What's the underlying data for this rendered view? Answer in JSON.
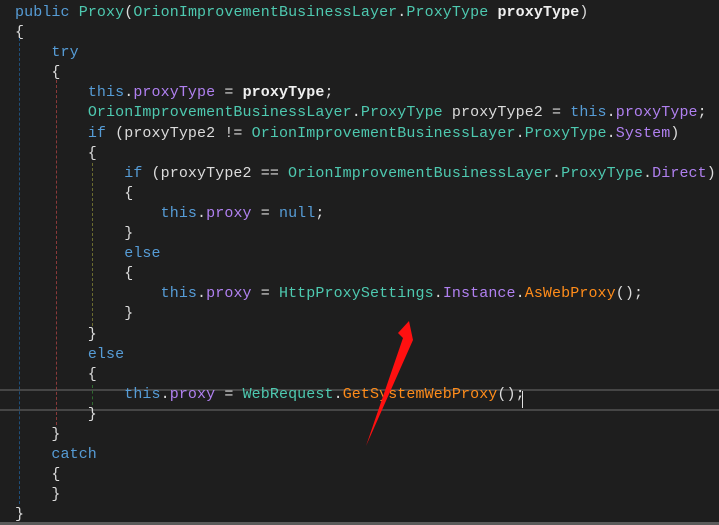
{
  "colors": {
    "background": "#1e1e1e",
    "keyword": "#569cd6",
    "type": "#4ec9b0",
    "member": "#b080f0",
    "method": "#ff8c1a",
    "annotation_arrow": "#ff1010"
  },
  "code": {
    "lines": [
      [
        [
          "public ",
          "kw"
        ],
        [
          "Proxy",
          "ty"
        ],
        [
          "(",
          "pu"
        ],
        [
          "OrionImprovementBusinessLayer",
          "ty"
        ],
        [
          ".",
          "pu"
        ],
        [
          "ProxyType",
          "ty"
        ],
        [
          " ",
          "pu"
        ],
        [
          "proxyType",
          "bo"
        ],
        [
          ")",
          "pu"
        ]
      ],
      [
        [
          "{",
          "pu"
        ]
      ],
      [
        [
          "    ",
          "pu"
        ],
        [
          "try",
          "kw"
        ]
      ],
      [
        [
          "    {",
          "pu"
        ]
      ],
      [
        [
          "        ",
          "pu"
        ],
        [
          "this",
          "kw"
        ],
        [
          ".",
          "pu"
        ],
        [
          "proxyType",
          "pr"
        ],
        [
          " = ",
          "pu"
        ],
        [
          "proxyType",
          "bo"
        ],
        [
          ";",
          "pu"
        ]
      ],
      [
        [
          "        ",
          "pu"
        ],
        [
          "OrionImprovementBusinessLayer",
          "ty"
        ],
        [
          ".",
          "pu"
        ],
        [
          "ProxyType",
          "ty"
        ],
        [
          " proxyType2 = ",
          "pu"
        ],
        [
          "this",
          "kw"
        ],
        [
          ".",
          "pu"
        ],
        [
          "proxyType",
          "pr"
        ],
        [
          ";",
          "pu"
        ]
      ],
      [
        [
          "        ",
          "pu"
        ],
        [
          "if",
          "kw"
        ],
        [
          " (proxyType2 != ",
          "pu"
        ],
        [
          "OrionImprovementBusinessLayer",
          "ty"
        ],
        [
          ".",
          "pu"
        ],
        [
          "ProxyType",
          "ty"
        ],
        [
          ".",
          "pu"
        ],
        [
          "System",
          "en"
        ],
        [
          ")",
          "pu"
        ]
      ],
      [
        [
          "        {",
          "pu"
        ]
      ],
      [
        [
          "            ",
          "pu"
        ],
        [
          "if",
          "kw"
        ],
        [
          " (proxyType2 == ",
          "pu"
        ],
        [
          "OrionImprovementBusinessLayer",
          "ty"
        ],
        [
          ".",
          "pu"
        ],
        [
          "ProxyType",
          "ty"
        ],
        [
          ".",
          "pu"
        ],
        [
          "Direct",
          "en"
        ],
        [
          ")",
          "pu"
        ]
      ],
      [
        [
          "            {",
          "pu"
        ]
      ],
      [
        [
          "                ",
          "pu"
        ],
        [
          "this",
          "kw"
        ],
        [
          ".",
          "pu"
        ],
        [
          "proxy",
          "pr"
        ],
        [
          " = ",
          "pu"
        ],
        [
          "null",
          "kw"
        ],
        [
          ";",
          "pu"
        ]
      ],
      [
        [
          "            }",
          "pu"
        ]
      ],
      [
        [
          "            ",
          "pu"
        ],
        [
          "else",
          "kw"
        ]
      ],
      [
        [
          "            {",
          "pu"
        ]
      ],
      [
        [
          "                ",
          "pu"
        ],
        [
          "this",
          "kw"
        ],
        [
          ".",
          "pu"
        ],
        [
          "proxy",
          "pr"
        ],
        [
          " = ",
          "pu"
        ],
        [
          "HttpProxySettings",
          "ty"
        ],
        [
          ".",
          "pu"
        ],
        [
          "Instance",
          "pr"
        ],
        [
          ".",
          "pu"
        ],
        [
          "AsWebProxy",
          "me"
        ],
        [
          "();",
          "pu"
        ]
      ],
      [
        [
          "            }",
          "pu"
        ]
      ],
      [
        [
          "        }",
          "pu"
        ]
      ],
      [
        [
          "        ",
          "pu"
        ],
        [
          "else",
          "kw"
        ]
      ],
      [
        [
          "        {",
          "pu"
        ]
      ],
      [
        [
          "            ",
          "pu"
        ],
        [
          "this",
          "kw"
        ],
        [
          ".",
          "pu"
        ],
        [
          "proxy",
          "pr"
        ],
        [
          " = ",
          "pu"
        ],
        [
          "WebRequest",
          "ty"
        ],
        [
          ".",
          "pu"
        ],
        [
          "GetSystemWebProxy",
          "me"
        ],
        [
          "();",
          "pu"
        ]
      ],
      [
        [
          "        }",
          "pu"
        ]
      ],
      [
        [
          "    }",
          "pu"
        ]
      ],
      [
        [
          "    ",
          "pu"
        ],
        [
          "catch",
          "kw"
        ]
      ],
      [
        [
          "    {",
          "pu"
        ]
      ],
      [
        [
          "    }",
          "pu"
        ]
      ],
      [
        [
          "}",
          "pu"
        ]
      ]
    ]
  }
}
